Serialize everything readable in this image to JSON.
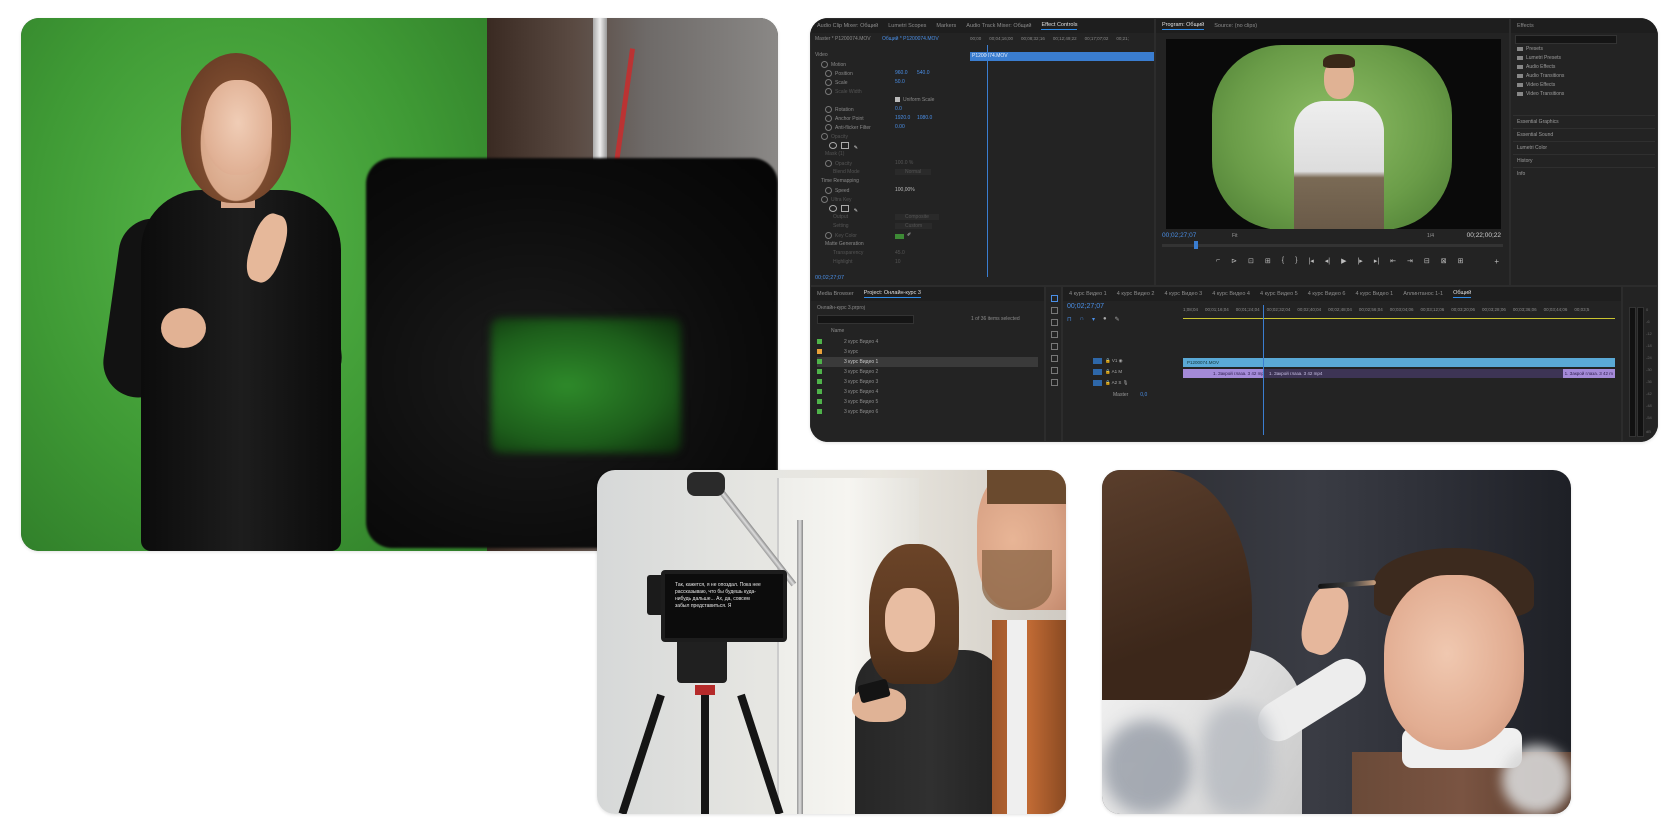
{
  "effect_controls": {
    "tabs": [
      "Audio Clip Mixer: Общий",
      "Lumetri Scopes",
      "Markers",
      "Audio Track Mixer: Общий",
      "Effect Controls"
    ],
    "master": "Master * P1200074.MOV",
    "sequence": "Общий * P1200074.MOV",
    "ruler": [
      "00;00",
      "00;04;16;00",
      "00;08;32;16",
      "00;12;49;22",
      "00;17;07;02",
      "00;21;"
    ],
    "clip_label": "P1200074.MOV",
    "section": "Video",
    "motion": "Motion",
    "position_label": "Position",
    "position_values": [
      "960.0",
      "540.0"
    ],
    "scale_label": "Scale",
    "scale_value": "50.0",
    "scale_width_label": "Scale Width",
    "uniform_scale": "Uniform Scale",
    "rotation_label": "Rotation",
    "rotation_value": "0.0",
    "anchor_label": "Anchor Point",
    "anchor_values": [
      "1920.0",
      "1080.0"
    ],
    "antiflicker_label": "Anti-flicker Filter",
    "antiflicker_value": "0.00",
    "opacity_section": "Opacity",
    "mask_label": "Mask (1)",
    "opacity_label": "Opacity",
    "opacity_value": "100.0 %",
    "blend_label": "Blend Mode",
    "blend_value": "Normal",
    "time_remap": "Time Remapping",
    "speed_label": "Speed",
    "speed_value": "100,00%",
    "ultra_key": "Ultra Key",
    "output_label": "Output",
    "output_value": "Composite",
    "setting_label": "Setting",
    "setting_value": "Custom",
    "key_color_label": "Key Color",
    "matte_gen": "Matte Generation",
    "transparency_label": "Transparency",
    "transparency_value": "45.0",
    "highlight_label": "Highlight",
    "highlight_value": "10",
    "timecode": "00;02;27;07"
  },
  "program_monitor": {
    "tabs": [
      "Program: Общий",
      "Source: (no clips)"
    ],
    "timecode_current": "00;02;27;07",
    "fit": "Fit",
    "zoom": "1/4",
    "timecode_duration": "00;22;00;22",
    "transport": [
      "⌐",
      "⊳",
      "⊡",
      "⊞",
      "{",
      "}",
      "|◂",
      "◂|",
      "▶",
      "|▸",
      "▸|",
      "⇤",
      "⇥",
      "⊟",
      "⊠",
      "⊞"
    ],
    "add_button": "+"
  },
  "effects_panel": {
    "title": "Effects",
    "folders": [
      "Presets",
      "Lumetri Presets",
      "Audio Effects",
      "Audio Transitions",
      "Video Effects",
      "Video Transitions"
    ],
    "sections": [
      "Essential Graphics",
      "Essential Sound",
      "Lumetri Color",
      "History",
      "Info"
    ]
  },
  "project_panel": {
    "tabs": [
      "Media Browser",
      "Project: Онлайн-курс 3"
    ],
    "project_file": "Онлайн-курс 3.prproj",
    "items_selected": "1 of 36 items selected",
    "column_name": "Name",
    "items": [
      {
        "label": "2 курс Видео 4",
        "color": "#4fb34a",
        "selected": false
      },
      {
        "label": "3 курс",
        "color": "#e9a13a",
        "selected": false
      },
      {
        "label": "3 курс Видео 1",
        "color": "#4fb34a",
        "selected": true
      },
      {
        "label": "3 курс Видео 2",
        "color": "#4fb34a",
        "selected": false
      },
      {
        "label": "3 курс Видео 3",
        "color": "#4fb34a",
        "selected": false
      },
      {
        "label": "3 курс Видео 4",
        "color": "#4fb34a",
        "selected": false
      },
      {
        "label": "3 курс Видео 5",
        "color": "#4fb34a",
        "selected": false
      },
      {
        "label": "3 курс Видео 6",
        "color": "#4fb34a",
        "selected": false
      }
    ]
  },
  "timeline": {
    "tabs": [
      "4 курс Видео 1",
      "4 курс Видео 2",
      "4 курс Видео 3",
      "4 курс Видео 4",
      "4 курс Видео 5",
      "4 курс Видео 6",
      "4 курс Видео 1",
      "Аплинтанос 1-1",
      "Общий"
    ],
    "timecode": "00;02;27;07",
    "ruler": [
      "1;08;04",
      "00;01;16;04",
      "00;01;24;04",
      "00;02;32;04",
      "00;02;40;04",
      "00;02;48;04",
      "00;02;56;04",
      "00;03;04;06",
      "00;03;12;06",
      "00;03;20;06",
      "00;03;28;06",
      "00;03;36;06",
      "00;03;44;06",
      "00;03;5"
    ],
    "tracks": [
      "V1",
      "A1",
      "A2"
    ],
    "video_clip": "P1200074.MOV",
    "audio_clip_a": "1. Закрой глаза. 3 42 mp4",
    "audio_clip_b": "1. Закрой глаза. 3 42 mp4",
    "audio_clip_c": "1. Закрой глаза. 3 42 m",
    "master_label": "Master",
    "master_value": "0,0"
  },
  "audio_meters": {
    "ticks": [
      "0",
      "-6",
      "-12",
      "-18",
      "-24",
      "-30",
      "-36",
      "-42",
      "-48",
      "-54",
      "dB"
    ]
  },
  "teleprompter_text": "Так, кажется, я не опоздал. Пока нее рассказываю, что бы будешь куда-нибудь дальше... Ах, да, совсем забыл представиться. Я"
}
